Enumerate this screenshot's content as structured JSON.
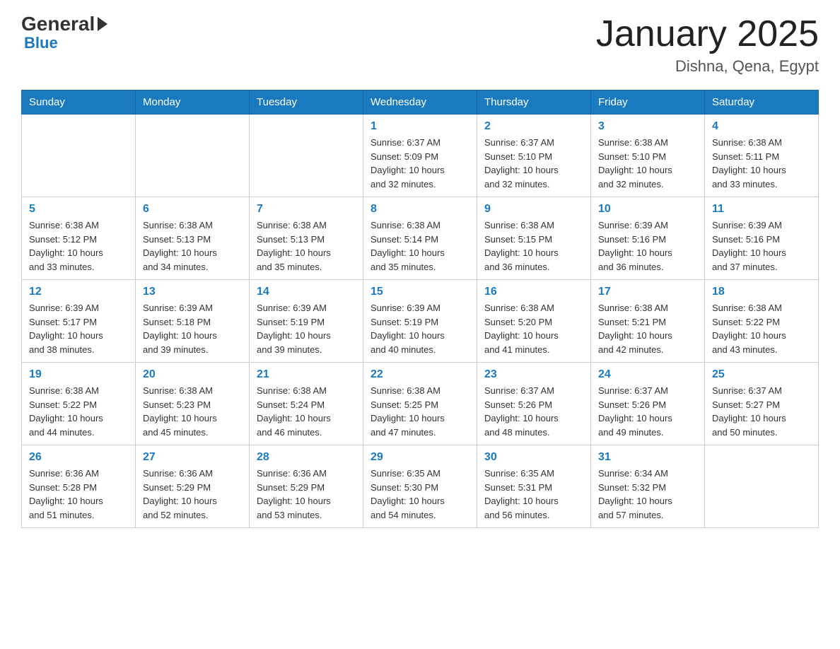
{
  "logo": {
    "general": "General",
    "blue": "Blue"
  },
  "title": "January 2025",
  "location": "Dishna, Qena, Egypt",
  "days_header": [
    "Sunday",
    "Monday",
    "Tuesday",
    "Wednesday",
    "Thursday",
    "Friday",
    "Saturday"
  ],
  "weeks": [
    [
      {
        "day": "",
        "info": ""
      },
      {
        "day": "",
        "info": ""
      },
      {
        "day": "",
        "info": ""
      },
      {
        "day": "1",
        "info": "Sunrise: 6:37 AM\nSunset: 5:09 PM\nDaylight: 10 hours\nand 32 minutes."
      },
      {
        "day": "2",
        "info": "Sunrise: 6:37 AM\nSunset: 5:10 PM\nDaylight: 10 hours\nand 32 minutes."
      },
      {
        "day": "3",
        "info": "Sunrise: 6:38 AM\nSunset: 5:10 PM\nDaylight: 10 hours\nand 32 minutes."
      },
      {
        "day": "4",
        "info": "Sunrise: 6:38 AM\nSunset: 5:11 PM\nDaylight: 10 hours\nand 33 minutes."
      }
    ],
    [
      {
        "day": "5",
        "info": "Sunrise: 6:38 AM\nSunset: 5:12 PM\nDaylight: 10 hours\nand 33 minutes."
      },
      {
        "day": "6",
        "info": "Sunrise: 6:38 AM\nSunset: 5:13 PM\nDaylight: 10 hours\nand 34 minutes."
      },
      {
        "day": "7",
        "info": "Sunrise: 6:38 AM\nSunset: 5:13 PM\nDaylight: 10 hours\nand 35 minutes."
      },
      {
        "day": "8",
        "info": "Sunrise: 6:38 AM\nSunset: 5:14 PM\nDaylight: 10 hours\nand 35 minutes."
      },
      {
        "day": "9",
        "info": "Sunrise: 6:38 AM\nSunset: 5:15 PM\nDaylight: 10 hours\nand 36 minutes."
      },
      {
        "day": "10",
        "info": "Sunrise: 6:39 AM\nSunset: 5:16 PM\nDaylight: 10 hours\nand 36 minutes."
      },
      {
        "day": "11",
        "info": "Sunrise: 6:39 AM\nSunset: 5:16 PM\nDaylight: 10 hours\nand 37 minutes."
      }
    ],
    [
      {
        "day": "12",
        "info": "Sunrise: 6:39 AM\nSunset: 5:17 PM\nDaylight: 10 hours\nand 38 minutes."
      },
      {
        "day": "13",
        "info": "Sunrise: 6:39 AM\nSunset: 5:18 PM\nDaylight: 10 hours\nand 39 minutes."
      },
      {
        "day": "14",
        "info": "Sunrise: 6:39 AM\nSunset: 5:19 PM\nDaylight: 10 hours\nand 39 minutes."
      },
      {
        "day": "15",
        "info": "Sunrise: 6:39 AM\nSunset: 5:19 PM\nDaylight: 10 hours\nand 40 minutes."
      },
      {
        "day": "16",
        "info": "Sunrise: 6:38 AM\nSunset: 5:20 PM\nDaylight: 10 hours\nand 41 minutes."
      },
      {
        "day": "17",
        "info": "Sunrise: 6:38 AM\nSunset: 5:21 PM\nDaylight: 10 hours\nand 42 minutes."
      },
      {
        "day": "18",
        "info": "Sunrise: 6:38 AM\nSunset: 5:22 PM\nDaylight: 10 hours\nand 43 minutes."
      }
    ],
    [
      {
        "day": "19",
        "info": "Sunrise: 6:38 AM\nSunset: 5:22 PM\nDaylight: 10 hours\nand 44 minutes."
      },
      {
        "day": "20",
        "info": "Sunrise: 6:38 AM\nSunset: 5:23 PM\nDaylight: 10 hours\nand 45 minutes."
      },
      {
        "day": "21",
        "info": "Sunrise: 6:38 AM\nSunset: 5:24 PM\nDaylight: 10 hours\nand 46 minutes."
      },
      {
        "day": "22",
        "info": "Sunrise: 6:38 AM\nSunset: 5:25 PM\nDaylight: 10 hours\nand 47 minutes."
      },
      {
        "day": "23",
        "info": "Sunrise: 6:37 AM\nSunset: 5:26 PM\nDaylight: 10 hours\nand 48 minutes."
      },
      {
        "day": "24",
        "info": "Sunrise: 6:37 AM\nSunset: 5:26 PM\nDaylight: 10 hours\nand 49 minutes."
      },
      {
        "day": "25",
        "info": "Sunrise: 6:37 AM\nSunset: 5:27 PM\nDaylight: 10 hours\nand 50 minutes."
      }
    ],
    [
      {
        "day": "26",
        "info": "Sunrise: 6:36 AM\nSunset: 5:28 PM\nDaylight: 10 hours\nand 51 minutes."
      },
      {
        "day": "27",
        "info": "Sunrise: 6:36 AM\nSunset: 5:29 PM\nDaylight: 10 hours\nand 52 minutes."
      },
      {
        "day": "28",
        "info": "Sunrise: 6:36 AM\nSunset: 5:29 PM\nDaylight: 10 hours\nand 53 minutes."
      },
      {
        "day": "29",
        "info": "Sunrise: 6:35 AM\nSunset: 5:30 PM\nDaylight: 10 hours\nand 54 minutes."
      },
      {
        "day": "30",
        "info": "Sunrise: 6:35 AM\nSunset: 5:31 PM\nDaylight: 10 hours\nand 56 minutes."
      },
      {
        "day": "31",
        "info": "Sunrise: 6:34 AM\nSunset: 5:32 PM\nDaylight: 10 hours\nand 57 minutes."
      },
      {
        "day": "",
        "info": ""
      }
    ]
  ]
}
